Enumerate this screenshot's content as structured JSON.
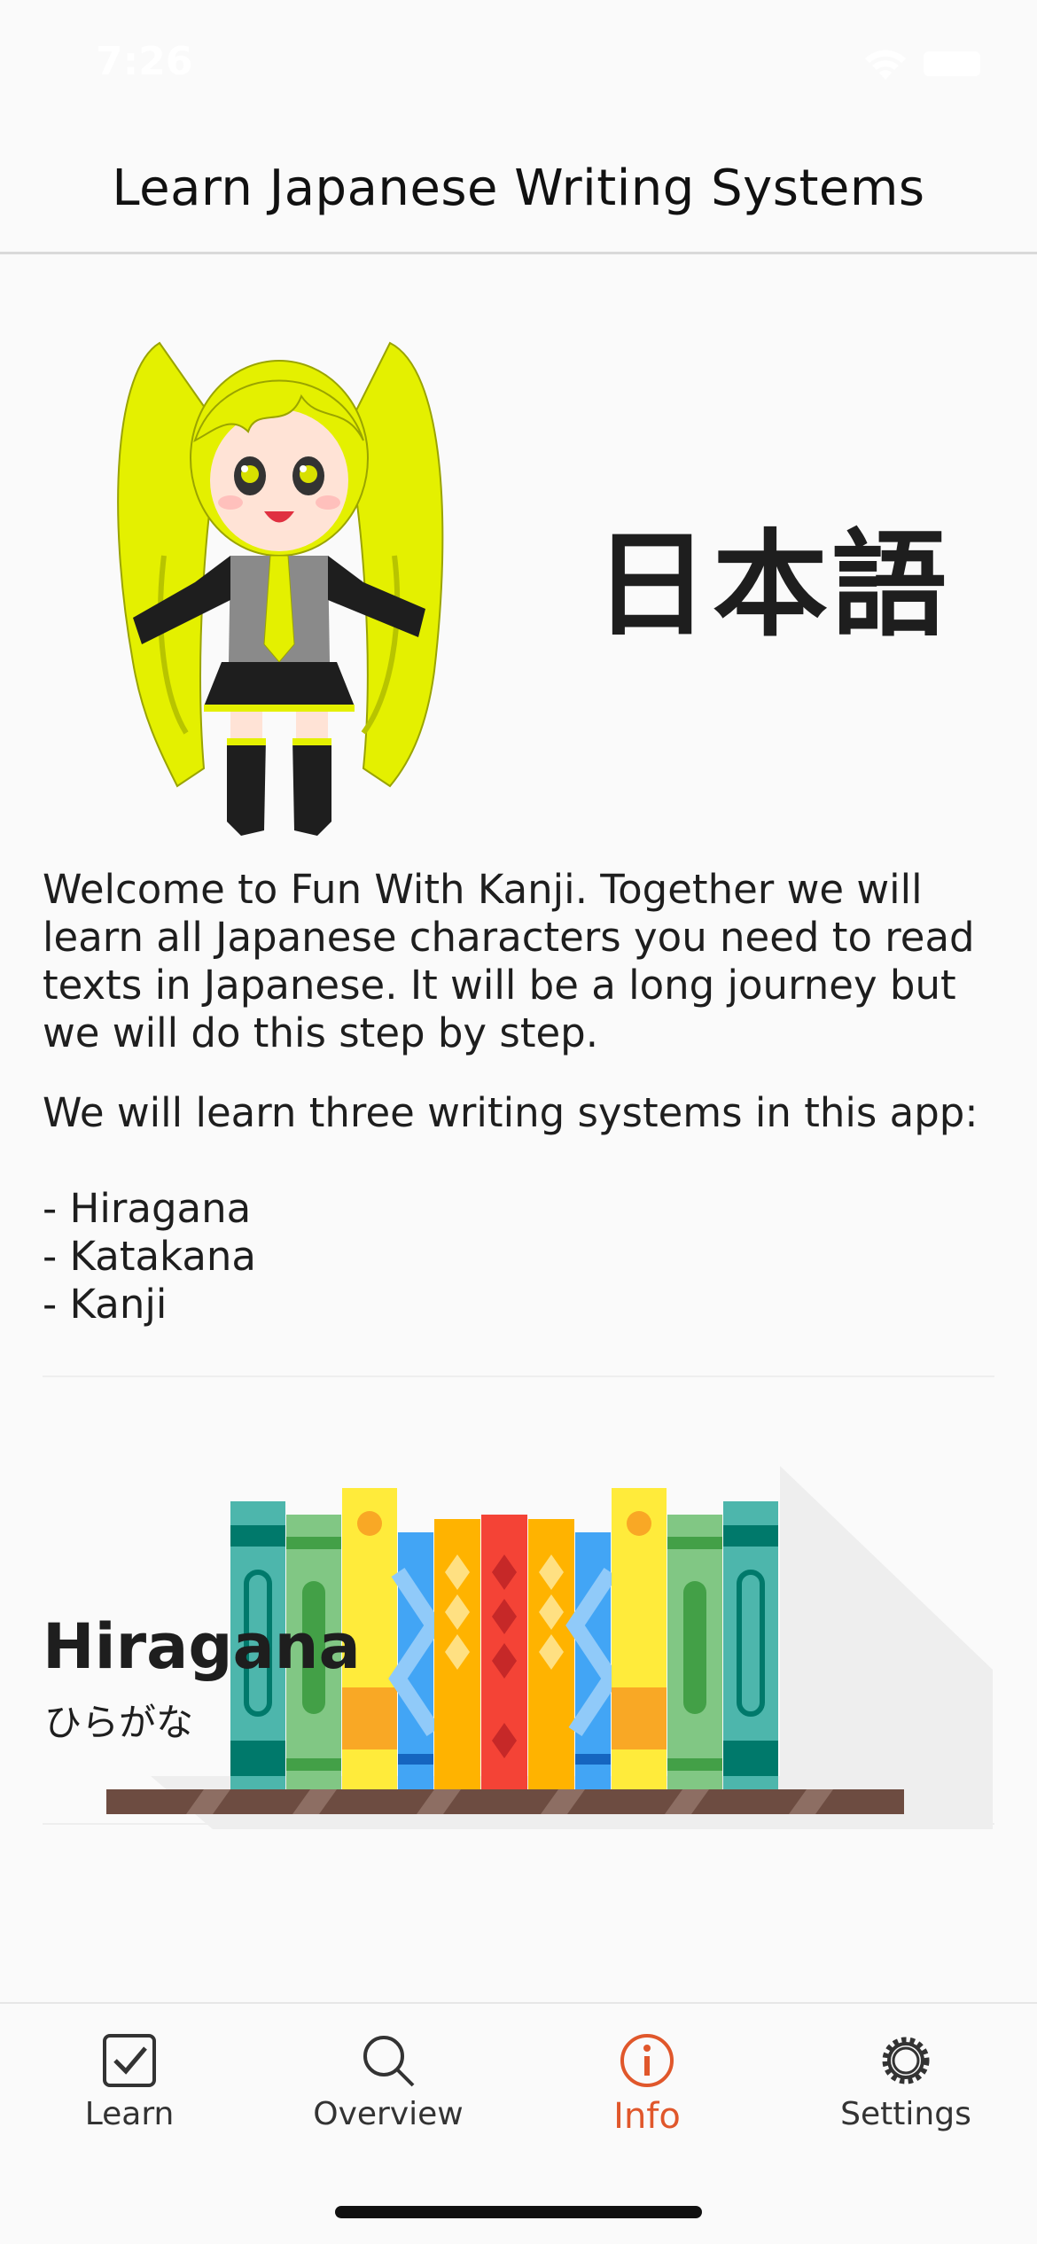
{
  "status_bar": {
    "time": "7:26"
  },
  "header": {
    "title": "Learn Japanese Writing Systems"
  },
  "hero": {
    "japanese_word": "日本語"
  },
  "intro": {
    "paragraph1": "Welcome to Fun With Kanji. Together we will learn all Japanese characters you need to read texts in Japanese. It will be a long journey but we will do this step by step.",
    "paragraph2": "We will learn three writing systems in this app:",
    "list": [
      "- Hiragana",
      "- Katakana",
      "- Kanji"
    ]
  },
  "section": {
    "title": "Hiragana",
    "subtitle": "ひらがな"
  },
  "tabs": [
    {
      "label": "Learn",
      "icon": "checkbox-icon",
      "active": false
    },
    {
      "label": "Overview",
      "icon": "search-icon",
      "active": false
    },
    {
      "label": "Info",
      "icon": "info-icon",
      "active": true
    },
    {
      "label": "Settings",
      "icon": "gear-icon",
      "active": false
    }
  ],
  "colors": {
    "accent": "#e0572b",
    "text": "#1e1e1e",
    "background": "#fafafa"
  }
}
